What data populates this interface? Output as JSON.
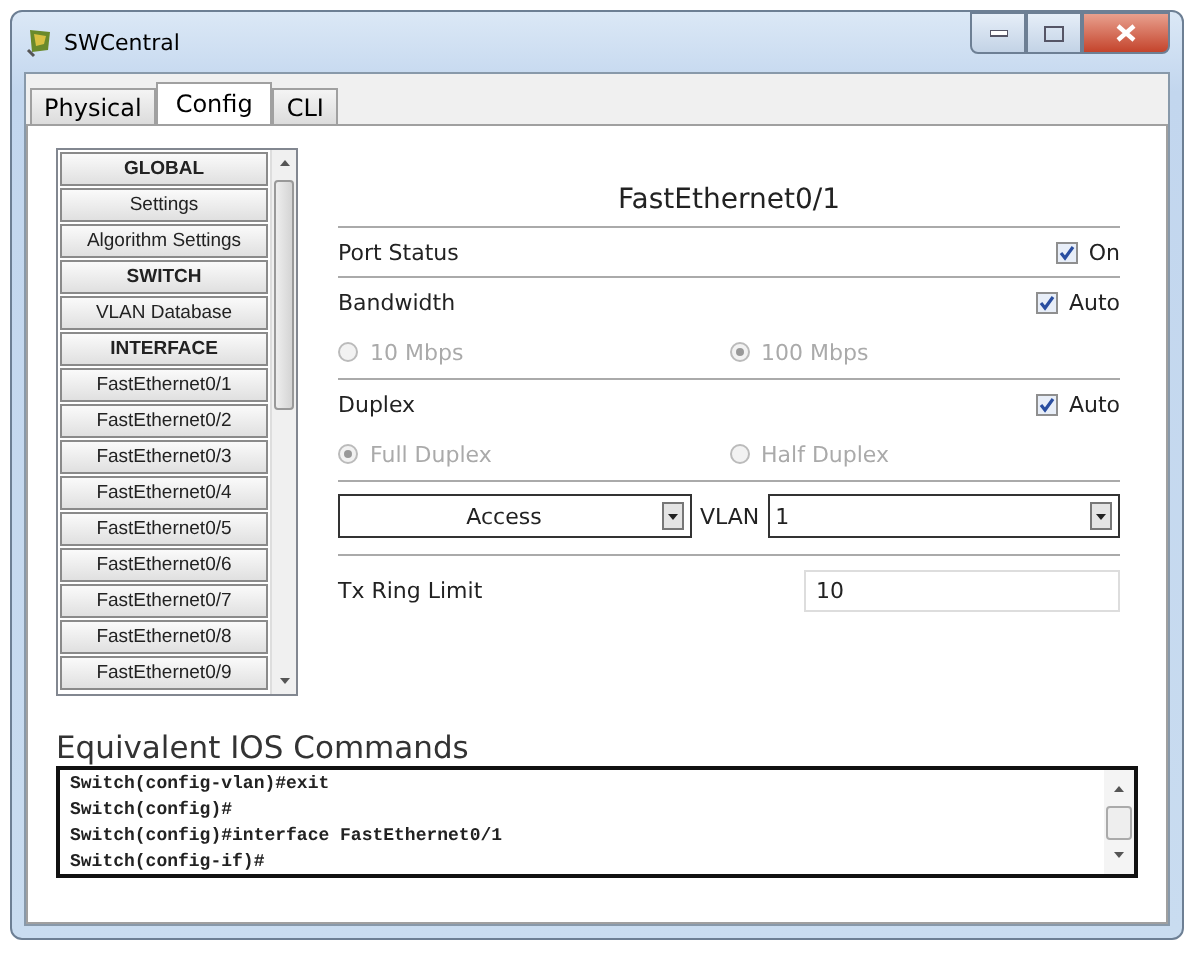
{
  "window": {
    "title": "SWCentral"
  },
  "tabs": [
    {
      "label": "Physical",
      "selected": false
    },
    {
      "label": "Config",
      "selected": true
    },
    {
      "label": "CLI",
      "selected": false
    }
  ],
  "sidebar": {
    "items": [
      {
        "kind": "header",
        "label": "GLOBAL"
      },
      {
        "kind": "item",
        "label": "Settings"
      },
      {
        "kind": "item",
        "label": "Algorithm Settings"
      },
      {
        "kind": "header",
        "label": "SWITCH"
      },
      {
        "kind": "item",
        "label": "VLAN Database"
      },
      {
        "kind": "header",
        "label": "INTERFACE"
      },
      {
        "kind": "item",
        "label": "FastEthernet0/1"
      },
      {
        "kind": "item",
        "label": "FastEthernet0/2"
      },
      {
        "kind": "item",
        "label": "FastEthernet0/3"
      },
      {
        "kind": "item",
        "label": "FastEthernet0/4"
      },
      {
        "kind": "item",
        "label": "FastEthernet0/5"
      },
      {
        "kind": "item",
        "label": "FastEthernet0/6"
      },
      {
        "kind": "item",
        "label": "FastEthernet0/7"
      },
      {
        "kind": "item",
        "label": "FastEthernet0/8"
      },
      {
        "kind": "item",
        "label": "FastEthernet0/9"
      }
    ]
  },
  "interface": {
    "title": "FastEthernet0/1",
    "port_status": {
      "label": "Port Status",
      "checkbox": {
        "label": "On",
        "checked": true
      }
    },
    "bandwidth": {
      "label": "Bandwidth",
      "auto": {
        "label": "Auto",
        "checked": true
      },
      "options": [
        {
          "label": "10 Mbps",
          "selected": false,
          "disabled": true
        },
        {
          "label": "100 Mbps",
          "selected": true,
          "disabled": true
        }
      ]
    },
    "duplex": {
      "label": "Duplex",
      "auto": {
        "label": "Auto",
        "checked": true
      },
      "options": [
        {
          "label": "Full Duplex",
          "selected": true,
          "disabled": true
        },
        {
          "label": "Half Duplex",
          "selected": false,
          "disabled": true
        }
      ]
    },
    "mode_select": {
      "value": "Access"
    },
    "vlan": {
      "label": "VLAN",
      "value": "1"
    },
    "tx_ring_limit": {
      "label": "Tx Ring Limit",
      "value": "10"
    }
  },
  "ios_commands": {
    "title": "Equivalent IOS Commands",
    "lines": [
      "Switch(config-vlan)#exit",
      "Switch(config)#",
      "Switch(config)#interface FastEthernet0/1",
      "Switch(config-if)#"
    ]
  }
}
